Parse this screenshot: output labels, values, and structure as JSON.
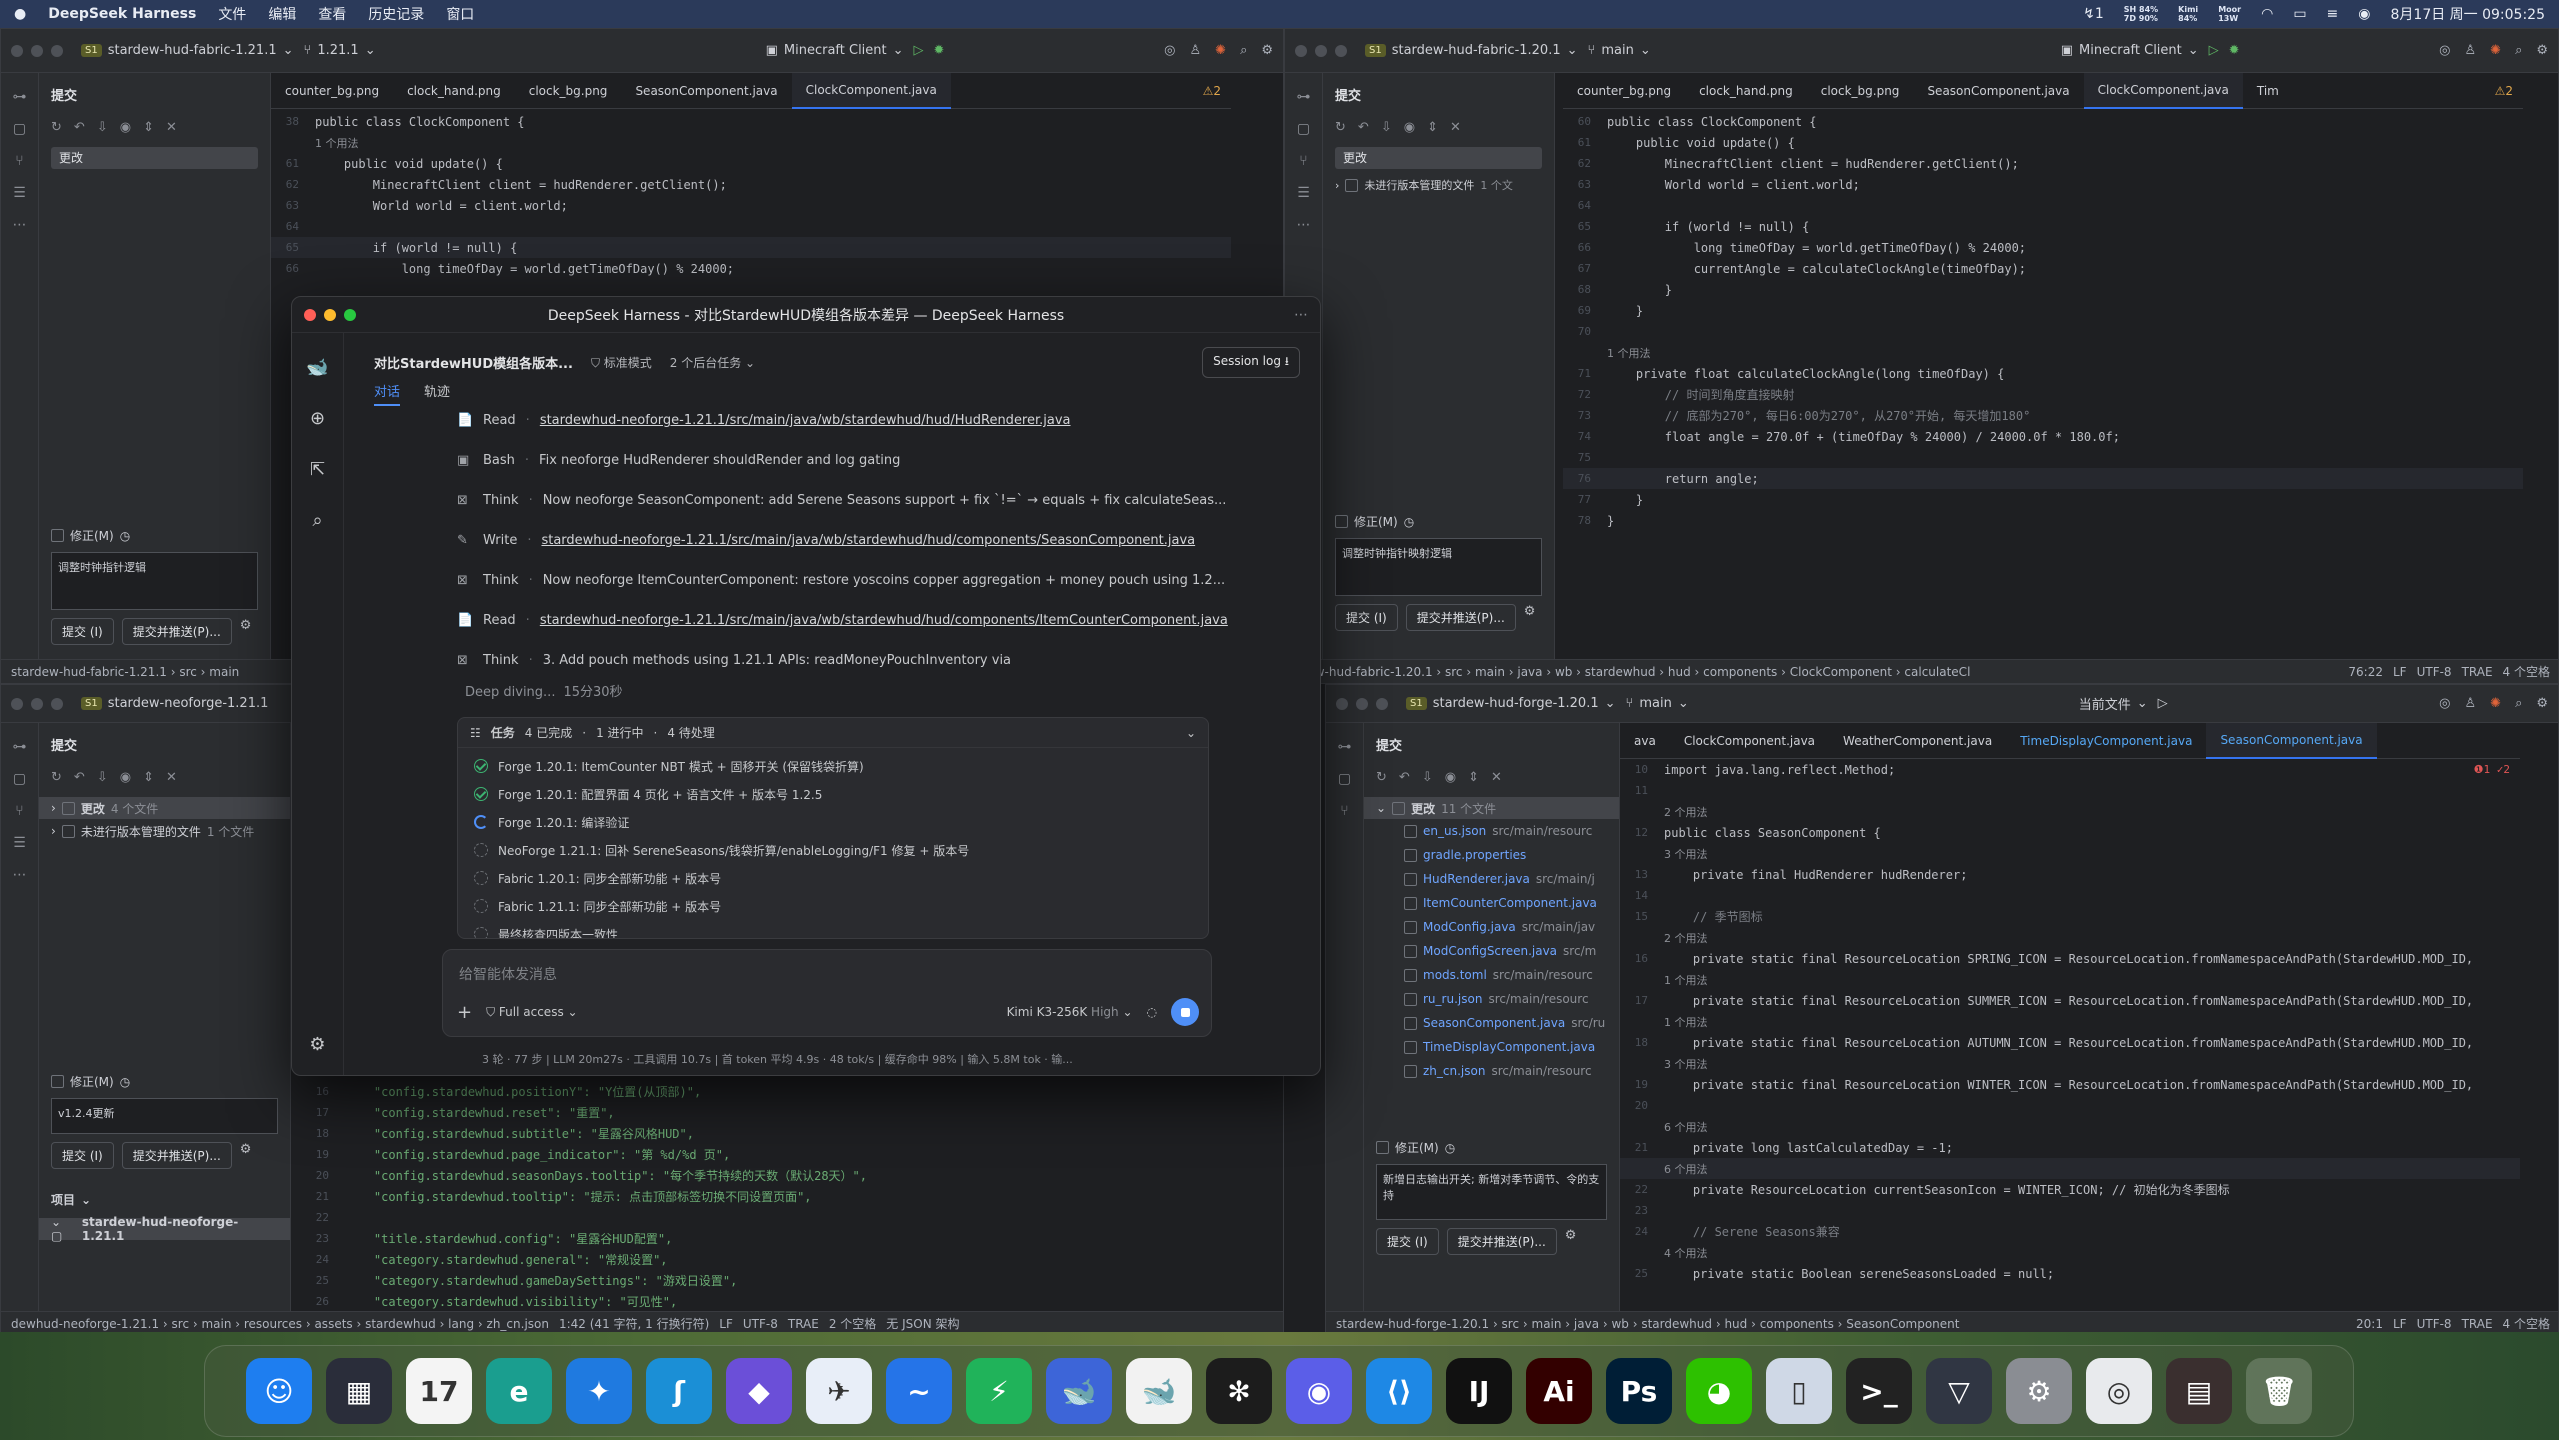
{
  "menubar": {
    "app": "DeepSeek Harness",
    "items": [
      "文件",
      "编辑",
      "查看",
      "历史记录",
      "窗口"
    ],
    "stats": [
      [
        "SH 84%",
        "7D 90%"
      ],
      [
        "Kimi",
        "84%"
      ],
      [
        "Moor",
        "13W"
      ]
    ],
    "datetime": "8月17日 周一 09:05:25"
  },
  "win_tl": {
    "project": "stardew-hud-fabric-1.21.1",
    "badge": "S1",
    "branch": "1.21.1",
    "run_config": "Minecraft Client",
    "panel_title": "提交",
    "changes_label": "更改",
    "amend_label": "修正(M)",
    "commit_msg": "调整时钟指针逻辑",
    "commit_btn": "提交 (I)",
    "commit_push_btn": "提交并推送(P)...",
    "tabs": [
      "counter_bg.png",
      "clock_hand.png",
      "clock_bg.png",
      "SeasonComponent.java",
      "ClockComponent.java"
    ],
    "active_tab": "ClockComponent.java",
    "warn": "⚠2",
    "code": [
      {
        "n": "38",
        "h": false,
        "t": "public class ClockComponent {"
      },
      {
        "n": "",
        "h": true,
        "t": "1 个用法"
      },
      {
        "n": "61",
        "h": false,
        "t": "    public void update() {"
      },
      {
        "n": "62",
        "h": false,
        "t": "        MinecraftClient client = hudRenderer.getClient();"
      },
      {
        "n": "63",
        "h": false,
        "t": "        World world = client.world;"
      },
      {
        "n": "64",
        "h": false,
        "t": ""
      },
      {
        "n": "65",
        "h": false,
        "t": "        if (world != null) {"
      },
      {
        "n": "66",
        "h": false,
        "t": "            long timeOfDay = world.getTimeOfDay() % 24000;"
      }
    ],
    "status": "stardew-hud-fabric-1.21.1 › src › main"
  },
  "win_tr": {
    "project": "stardew-hud-fabric-1.20.1",
    "badge": "S1",
    "branch": "main",
    "run_config": "Minecraft Client",
    "panel_title": "提交",
    "changes_label": "更改",
    "unversioned": "未进行版本管理的文件",
    "unversioned_count": "1 个文",
    "amend_label": "修正(M)",
    "commit_msg": "调整时钟指针映射逻辑",
    "commit_btn": "提交 (I)",
    "commit_push_btn": "提交并推送(P)...",
    "tabs": [
      "counter_bg.png",
      "clock_hand.png",
      "clock_bg.png",
      "SeasonComponent.java",
      "ClockComponent.java",
      "Tim"
    ],
    "active_tab": "ClockComponent.java",
    "warn": "⚠2",
    "code": [
      {
        "n": "60",
        "h": false,
        "t": "public class ClockComponent {"
      },
      {
        "n": "61",
        "h": false,
        "t": "    public void update() {"
      },
      {
        "n": "62",
        "h": false,
        "t": "        MinecraftClient client = hudRenderer.getClient();"
      },
      {
        "n": "63",
        "h": false,
        "t": "        World world = client.world;"
      },
      {
        "n": "64",
        "h": false,
        "t": ""
      },
      {
        "n": "65",
        "h": false,
        "t": "        if (world != null) {"
      },
      {
        "n": "66",
        "h": false,
        "t": "            long timeOfDay = world.getTimeOfDay() % 24000;"
      },
      {
        "n": "67",
        "h": false,
        "t": "            currentAngle = calculateClockAngle(timeOfDay);"
      },
      {
        "n": "68",
        "h": false,
        "t": "        }"
      },
      {
        "n": "69",
        "h": false,
        "t": "    }"
      },
      {
        "n": "70",
        "h": false,
        "t": ""
      },
      {
        "n": "",
        "h": true,
        "t": "1 个用法"
      },
      {
        "n": "71",
        "h": false,
        "t": "    private float calculateClockAngle(long timeOfDay) {"
      },
      {
        "n": "72",
        "h": false,
        "t": "        // 时间到角度直接映射"
      },
      {
        "n": "73",
        "h": false,
        "t": "        // 底部为270°, 每日6:00为270°, 从270°开始, 每天增加180°"
      },
      {
        "n": "74",
        "h": false,
        "t": "        float angle = 270.0f + (timeOfDay % 24000) / 24000.0f * 180.0f;"
      },
      {
        "n": "75",
        "h": false,
        "t": ""
      },
      {
        "n": "76",
        "h": false,
        "t": "        return angle;"
      },
      {
        "n": "77",
        "h": false,
        "t": "    }"
      },
      {
        "n": "78",
        "h": false,
        "t": "}"
      }
    ],
    "status": "rdew-hud-fabric-1.20.1 › src › main › java › wb › stardewhud › hud › components › ClockComponent › calculateCl",
    "pos": "76:22",
    "lf": "LF",
    "enc": "UTF-8",
    "extra": "TRAE",
    "indent": "4 个空格"
  },
  "win_bl": {
    "project": "stardew-neoforge-1.21.1",
    "badge": "S1",
    "panel_title": "提交",
    "changes_label": "更改",
    "changes_count": "4 个文件",
    "unversioned": "未进行版本管理的文件",
    "unversioned_count": "1 个文件",
    "amend_label": "修正(M)",
    "commit_msg": "v1.2.4更新",
    "commit_btn": "提交 (I)",
    "commit_push_btn": "提交并推送(P)...",
    "project_label": "项目",
    "project_item": "stardew-hud-neoforge-1.21.1",
    "code": [
      {
        "n": "16",
        "t": "    \"config.stardewhud.positionY\": \"Y位置(从顶部)\","
      },
      {
        "n": "17",
        "t": "    \"config.stardewhud.reset\": \"重置\","
      },
      {
        "n": "18",
        "t": "    \"config.stardewhud.subtitle\": \"星露谷风格HUD\","
      },
      {
        "n": "19",
        "t": "    \"config.stardewhud.page_indicator\": \"第 %d/%d 页\","
      },
      {
        "n": "20",
        "t": "    \"config.stardewhud.seasonDays.tooltip\": \"每个季节持续的天数（默认28天）\","
      },
      {
        "n": "21",
        "t": "    \"config.stardewhud.tooltip\": \"提示: 点击顶部标签切换不同设置页面\","
      },
      {
        "n": "22",
        "t": ""
      },
      {
        "n": "23",
        "t": "    \"title.stardewhud.config\": \"星露谷HUD配置\","
      },
      {
        "n": "24",
        "t": "    \"category.stardewhud.general\": \"常规设置\","
      },
      {
        "n": "25",
        "t": "    \"category.stardewhud.gameDaySettings\": \"游戏日设置\","
      },
      {
        "n": "26",
        "t": "    \"category.stardewhud.visibility\": \"可见性\","
      }
    ],
    "status": "dewhud-neoforge-1.21.1 › src › main › resources › assets › stardewhud › lang › zh_cn.json",
    "pos": "1:42 (41 字符, 1 行换行符)",
    "lf": "LF",
    "enc": "UTF-8",
    "extra": "TRAE",
    "indent": "2 个空格",
    "schema": "无 JSON 架构"
  },
  "win_br": {
    "project": "stardew-hud-forge-1.20.1",
    "badge": "S1",
    "branch": "main",
    "current_file": "当前文件",
    "panel_title": "提交",
    "changes_label": "更改",
    "changes_count": "11 个文件",
    "amend_label": "修正(M)",
    "commit_msg": "新增日志输出开关; 新增对季节调节、令的支持",
    "commit_btn": "提交 (I)",
    "commit_push_btn": "提交并推送(P)...",
    "files": [
      {
        "name": "en_us.json",
        "path": "src/main/resourc"
      },
      {
        "name": "gradle.properties",
        "path": ""
      },
      {
        "name": "HudRenderer.java",
        "path": "src/main/j"
      },
      {
        "name": "ItemCounterComponent.java",
        "path": ""
      },
      {
        "name": "ModConfig.java",
        "path": "src/main/jav"
      },
      {
        "name": "ModConfigScreen.java",
        "path": "src/m"
      },
      {
        "name": "mods.toml",
        "path": "src/main/resourc"
      },
      {
        "name": "ru_ru.json",
        "path": "src/main/resourc"
      },
      {
        "name": "SeasonComponent.java",
        "path": "src/ru"
      },
      {
        "name": "TimeDisplayComponent.java",
        "path": ""
      },
      {
        "name": "zh_cn.json",
        "path": "src/main/resourc"
      }
    ],
    "tabs": [
      "ava",
      "ClockComponent.java",
      "WeatherComponent.java",
      "TimeDisplayComponent.java",
      "SeasonComponent.java"
    ],
    "active_tab": "SeasonComponent.java",
    "warn": "❶1 ✓2",
    "code": [
      {
        "n": "10",
        "h": false,
        "t": "import java.lang.reflect.Method;"
      },
      {
        "n": "11",
        "h": false,
        "t": ""
      },
      {
        "n": "",
        "h": true,
        "t": "2 个用法"
      },
      {
        "n": "12",
        "h": false,
        "t": "public class SeasonComponent {"
      },
      {
        "n": "",
        "h": true,
        "t": "3 个用法"
      },
      {
        "n": "13",
        "h": false,
        "t": "    private final HudRenderer hudRenderer;"
      },
      {
        "n": "14",
        "h": false,
        "t": ""
      },
      {
        "n": "15",
        "h": false,
        "t": "    // 季节图标"
      },
      {
        "n": "",
        "h": true,
        "t": "2 个用法"
      },
      {
        "n": "16",
        "h": false,
        "t": "    private static final ResourceLocation SPRING_ICON = ResourceLocation.fromNamespaceAndPath(StardewHUD.MOD_ID,"
      },
      {
        "n": "",
        "h": true,
        "t": "1 个用法"
      },
      {
        "n": "17",
        "h": false,
        "t": "    private static final ResourceLocation SUMMER_ICON = ResourceLocation.fromNamespaceAndPath(StardewHUD.MOD_ID,"
      },
      {
        "n": "",
        "h": true,
        "t": "1 个用法"
      },
      {
        "n": "18",
        "h": false,
        "t": "    private static final ResourceLocation AUTUMN_ICON = ResourceLocation.fromNamespaceAndPath(StardewHUD.MOD_ID,"
      },
      {
        "n": "",
        "h": true,
        "t": "3 个用法"
      },
      {
        "n": "19",
        "h": false,
        "t": "    private static final ResourceLocation WINTER_ICON = ResourceLocation.fromNamespaceAndPath(StardewHUD.MOD_ID,"
      },
      {
        "n": "20",
        "h": false,
        "t": ""
      },
      {
        "n": "",
        "h": true,
        "t": "6 个用法"
      },
      {
        "n": "21",
        "h": false,
        "t": "    private long lastCalculatedDay = -1;"
      },
      {
        "n": "",
        "h": true,
        "t": "6 个用法"
      },
      {
        "n": "22",
        "h": false,
        "t": "    private ResourceLocation currentSeasonIcon = WINTER_ICON; // 初始化为冬季图标"
      },
      {
        "n": "23",
        "h": false,
        "t": ""
      },
      {
        "n": "24",
        "h": false,
        "t": "    // Serene Seasons兼容"
      },
      {
        "n": "",
        "h": true,
        "t": "4 个用法"
      },
      {
        "n": "25",
        "h": false,
        "t": "    private static Boolean sereneSeasonsLoaded = null;"
      }
    ],
    "status": "stardew-hud-forge-1.20.1 › src › main › java › wb › stardewhud › hud › components › SeasonComponent",
    "pos": "20:1",
    "lf": "LF",
    "enc": "UTF-8",
    "extra": "TRAE",
    "indent": "4 个空格"
  },
  "deepseek": {
    "window_title": "DeepSeek Harness - 对比StardewHUD模组各版本差异 — DeepSeek Harness",
    "session_title": "对比StardewHUD模组各版本...",
    "mode": "标准模式",
    "bg_tasks": "2 个后台任务",
    "session_log": "Session log ⭳",
    "tab_chat": "对话",
    "tab_trace": "轨迹",
    "tools": [
      {
        "icon": "📄",
        "kind": "Read",
        "text": "stardewhud-neoforge-1.21.1/src/main/java/wb/stardewhud/hud/HudRenderer.java",
        "link": true
      },
      {
        "icon": "▣",
        "kind": "Bash",
        "text": "Fix neoforge HudRenderer shouldRender and log gating",
        "link": false
      },
      {
        "icon": "⊠",
        "kind": "Think",
        "text": "Now neoforge SeasonComponent: add Serene Seasons support + fix `!=` → equals + fix calculateSeas...",
        "link": false
      },
      {
        "icon": "✎",
        "kind": "Write",
        "text": "stardewhud-neoforge-1.21.1/src/main/java/wb/stardewhud/hud/components/SeasonComponent.java",
        "link": true
      },
      {
        "icon": "⊠",
        "kind": "Think",
        "text": "Now neoforge ItemCounterComponent: restore yoscoins copper aggregation + money pouch using 1.2...",
        "link": false
      },
      {
        "icon": "📄",
        "kind": "Read",
        "text": "stardewhud-neoforge-1.21.1/src/main/java/wb/stardewhud/hud/components/ItemCounterComponent.java",
        "link": true
      },
      {
        "icon": "⊠",
        "kind": "Think",
        "text": "3. Add pouch methods using 1.21.1 APIs: readMoneyPouchInventory via",
        "link": false
      }
    ],
    "deep_diving": "Deep diving...",
    "elapsed": "15分30秒",
    "tasks_header": "任务",
    "tasks_done": "4 已完成",
    "tasks_running": "1 进行中",
    "tasks_pending": "4 待处理",
    "tasks": [
      {
        "s": "done",
        "t": "Forge 1.20.1: ItemCounter NBT 模式 + 固移开关 (保留钱袋折算)"
      },
      {
        "s": "done",
        "t": "Forge 1.20.1: 配置界面 4 页化 + 语言文件 + 版本号 1.2.5"
      },
      {
        "s": "run",
        "t": "Forge 1.20.1: 编译验证"
      },
      {
        "s": "todo",
        "t": "NeoForge 1.21.1: 回补 SereneSeasons/钱袋折算/enableLogging/F1 修复 + 版本号"
      },
      {
        "s": "todo",
        "t": "Fabric 1.20.1: 同步全部新功能 + 版本号"
      },
      {
        "s": "todo",
        "t": "Fabric 1.21.1: 同步全部新功能 + 版本号"
      },
      {
        "s": "todo",
        "t": "最终核查四版本一致性"
      }
    ],
    "input_placeholder": "给智能体发消息",
    "access": "Full access",
    "model": "Kimi K3-256K",
    "effort": "High",
    "footer": "3 轮 · 77 步  |  LLM 20m27s · 工具调用 10.7s  |  首 token 平均 4.9s · 48 tok/s  |  缓存命中 98%  |  输入 5.8M tok · 输..."
  },
  "dock": [
    {
      "n": "finder",
      "g": "☺",
      "c": "#1e7ef0"
    },
    {
      "n": "launchpad",
      "g": "▦",
      "c": "#2a2d3a"
    },
    {
      "n": "calendar",
      "g": "17",
      "c": "#f4f4f4"
    },
    {
      "n": "edge",
      "g": "e",
      "c": "#1a9e8f"
    },
    {
      "n": "safari",
      "g": "✦",
      "c": "#1f7ae0"
    },
    {
      "n": "app6",
      "g": "ʃ",
      "c": "#1b8fd6"
    },
    {
      "n": "app7",
      "g": "◆",
      "c": "#6b4fd8"
    },
    {
      "n": "app8",
      "g": "✈",
      "c": "#e8eef8"
    },
    {
      "n": "app9",
      "g": "~",
      "c": "#2574e8"
    },
    {
      "n": "app10",
      "g": "⚡",
      "c": "#20b35a"
    },
    {
      "n": "deepseek",
      "g": "🐋",
      "c": "#3d65d8"
    },
    {
      "n": "deepseek2",
      "g": "🐋",
      "c": "#f2f2f2"
    },
    {
      "n": "chatgpt",
      "g": "✻",
      "c": "#1c1c1c"
    },
    {
      "n": "app14",
      "g": "◉",
      "c": "#5b5ee8"
    },
    {
      "n": "vscode",
      "g": "⟨⟩",
      "c": "#1e88e5"
    },
    {
      "n": "intellij",
      "g": "IJ",
      "c": "#111"
    },
    {
      "n": "illustrator",
      "g": "Ai",
      "c": "#330000"
    },
    {
      "n": "photoshop",
      "g": "Ps",
      "c": "#001e36"
    },
    {
      "n": "wechat",
      "g": "◕",
      "c": "#2dc100"
    },
    {
      "n": "app20",
      "g": "▯",
      "c": "#cfd8e6"
    },
    {
      "n": "terminal",
      "g": ">_",
      "c": "#222"
    },
    {
      "n": "app22",
      "g": "▽",
      "c": "#303643"
    },
    {
      "n": "settings",
      "g": "⚙",
      "c": "#8a8d93"
    },
    {
      "n": "chrome",
      "g": "◎",
      "c": "#e8eaed"
    },
    {
      "n": "app25",
      "g": "▤",
      "c": "#3a2f2f"
    },
    {
      "n": "trash",
      "g": "🗑",
      "c": "rgba(255,255,255,.18)"
    }
  ]
}
